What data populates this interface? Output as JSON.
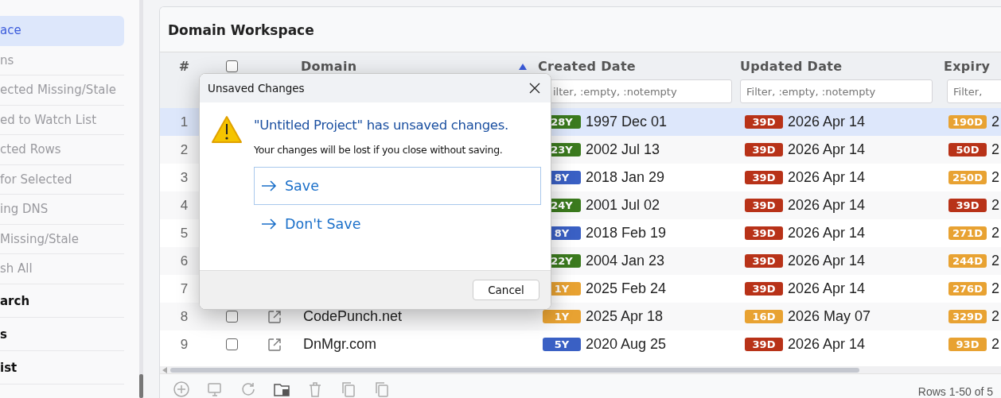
{
  "sidebar": {
    "items": [
      {
        "label": "ace",
        "kind": "action",
        "selected": true
      },
      {
        "label": "ns",
        "kind": "action",
        "selected": false
      },
      {
        "label": "ected Missing/Stale",
        "kind": "action",
        "selected": false
      },
      {
        "label": "ed to Watch List",
        "kind": "action",
        "selected": false
      },
      {
        "label": "cted Rows",
        "kind": "action",
        "selected": false
      },
      {
        "label": " for Selected",
        "kind": "action",
        "selected": false
      },
      {
        "label": "ing DNS",
        "kind": "action",
        "selected": false
      },
      {
        "label": "Missing/Stale",
        "kind": "action",
        "selected": false
      },
      {
        "label": "sh All",
        "kind": "action",
        "selected": false
      },
      {
        "label": "arch",
        "kind": "section",
        "selected": false
      },
      {
        "label": "s",
        "kind": "section",
        "selected": false
      },
      {
        "label": "ist",
        "kind": "section",
        "selected": false
      }
    ]
  },
  "workspace": {
    "title": "Domain Workspace",
    "columns": [
      {
        "label": "#",
        "kind": "number"
      },
      {
        "kind": "check",
        "checked": false
      },
      {
        "kind": "link"
      },
      {
        "label": "Domain",
        "kind": "text",
        "sorted": true
      },
      {
        "label": "Created Date",
        "kind": "date",
        "placeholder": "ilter, :empty, :notempty"
      },
      {
        "label": "Updated Date",
        "kind": "date",
        "placeholder": "Filter, :empty, :notempty"
      },
      {
        "label": "Expiry",
        "kind": "date",
        "placeholder": "Filter,"
      }
    ],
    "rows": [
      {
        "number": "1",
        "selected": true,
        "created": {
          "age": "28Y",
          "color": "#3b7a1e",
          "date": "1997 Dec 01"
        },
        "updated": {
          "age": "39D",
          "color": "#b83218",
          "date": "2026 Apr 14"
        },
        "expiry": {
          "age": "190D",
          "color": "#e8a232",
          "date": "2"
        }
      },
      {
        "number": "2",
        "selected": false,
        "created": {
          "age": "23Y",
          "color": "#3b7a1e",
          "date": "2002 Jul 13"
        },
        "updated": {
          "age": "39D",
          "color": "#b83218",
          "date": "2026 Apr 14"
        },
        "expiry": {
          "age": "50D",
          "color": "#b83218",
          "date": "2"
        }
      },
      {
        "number": "3",
        "selected": false,
        "created": {
          "age": "8Y",
          "color": "#3a60c4",
          "date": "2018 Jan 29"
        },
        "updated": {
          "age": "39D",
          "color": "#b83218",
          "date": "2026 Apr 14"
        },
        "expiry": {
          "age": "250D",
          "color": "#e8a232",
          "date": "2"
        }
      },
      {
        "number": "4",
        "selected": false,
        "created": {
          "age": "24Y",
          "color": "#3b7a1e",
          "date": "2001 Jul 02"
        },
        "updated": {
          "age": "39D",
          "color": "#b83218",
          "date": "2026 Apr 14"
        },
        "expiry": {
          "age": "39D",
          "color": "#b83218",
          "date": "2"
        }
      },
      {
        "number": "5",
        "selected": false,
        "created": {
          "age": "8Y",
          "color": "#3a60c4",
          "date": "2018 Feb 19"
        },
        "updated": {
          "age": "39D",
          "color": "#b83218",
          "date": "2026 Apr 14"
        },
        "expiry": {
          "age": "271D",
          "color": "#e8a232",
          "date": "2"
        }
      },
      {
        "number": "6",
        "selected": false,
        "created": {
          "age": "22Y",
          "color": "#3b7a1e",
          "date": "2004 Jan 23"
        },
        "updated": {
          "age": "39D",
          "color": "#b83218",
          "date": "2026 Apr 14"
        },
        "expiry": {
          "age": "244D",
          "color": "#e8a232",
          "date": "2"
        }
      },
      {
        "number": "7",
        "selected": false,
        "created": {
          "age": "1Y",
          "color": "#e8a232",
          "date": "2025 Feb 24"
        },
        "updated": {
          "age": "39D",
          "color": "#b83218",
          "date": "2026 Apr 14"
        },
        "expiry": {
          "age": "276D",
          "color": "#e8a232",
          "date": "2"
        }
      },
      {
        "number": "8",
        "selected": false,
        "checked": false,
        "domain": "CodePunch.net",
        "created": {
          "age": "1Y",
          "color": "#e8a232",
          "date": "2025 Apr 18"
        },
        "updated": {
          "age": "16D",
          "color": "#e8a232",
          "date": "2026 May 07"
        },
        "expiry": {
          "age": "329D",
          "color": "#e8a232",
          "date": "2"
        }
      },
      {
        "number": "9",
        "selected": false,
        "checked": false,
        "domain": "DnMgr.com",
        "created": {
          "age": "5Y",
          "color": "#3a60c4",
          "date": "2020 Aug 25"
        },
        "updated": {
          "age": "39D",
          "color": "#b83218",
          "date": "2026 Apr 14"
        },
        "expiry": {
          "age": "93D",
          "color": "#e8a232",
          "date": "2"
        }
      }
    ],
    "footer": {
      "summary": "Rows 1-50 of 5"
    }
  },
  "dialog": {
    "title": "Unsaved Changes",
    "heading": "\"Untitled Project\" has unsaved changes.",
    "message": "Your changes will be lost if you close without saving.",
    "options": [
      {
        "label": "Save",
        "focused": true
      },
      {
        "label": "Don't Save",
        "focused": false
      }
    ],
    "button": "Cancel"
  }
}
